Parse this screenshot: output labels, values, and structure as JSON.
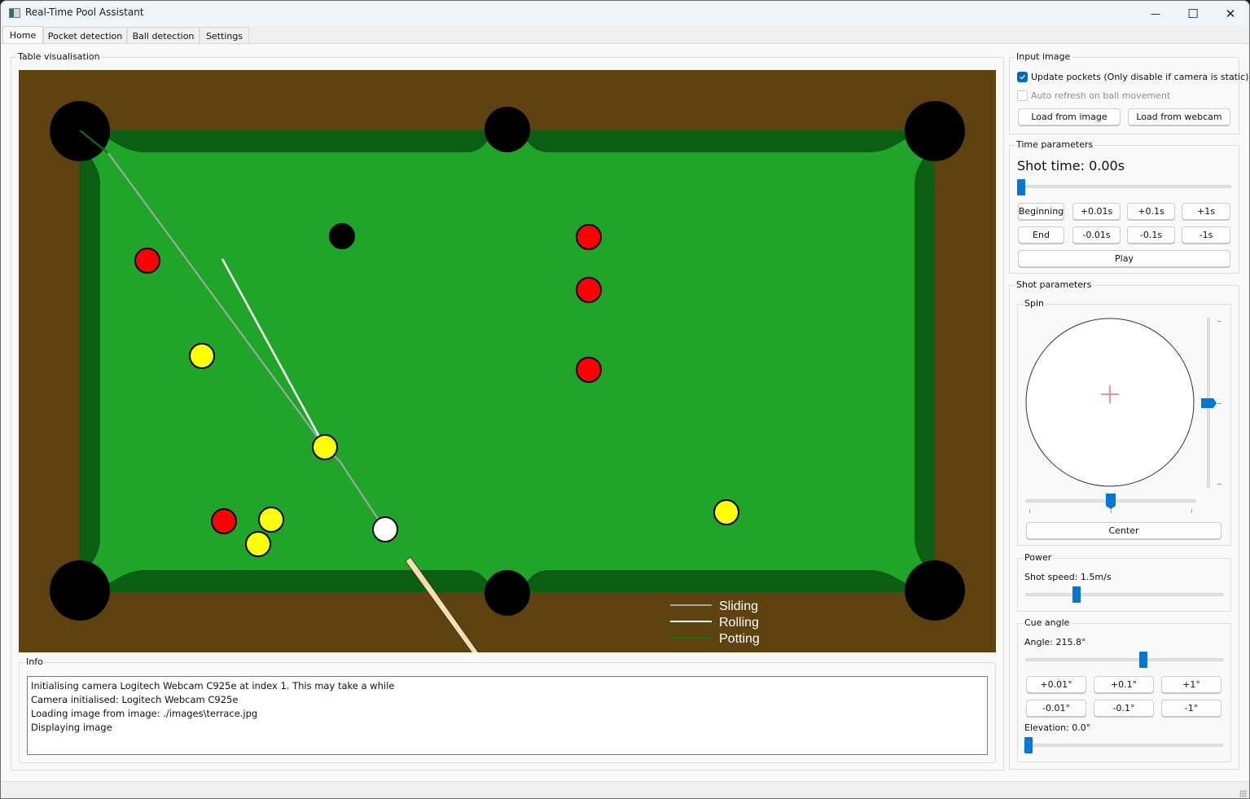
{
  "window": {
    "title": "Real-Time Pool Assistant",
    "controls": {
      "minimize": "—",
      "maximize": "☐",
      "close": "✕"
    }
  },
  "tabs": [
    {
      "label": "Home",
      "active": true
    },
    {
      "label": "Pocket detection",
      "active": false
    },
    {
      "label": "Ball detection",
      "active": false
    },
    {
      "label": "Settings",
      "active": false
    }
  ],
  "table_visualisation": {
    "title": "Table visualisation",
    "colors": {
      "frame": "#5e4210",
      "cushion": "#0b5e12",
      "cloth": "#1fa628",
      "pocket": "#000000",
      "cue": "#f5deb3",
      "sliding": "#a8a8a8",
      "rolling": "#ffffff",
      "potting": "#0b7a0b"
    },
    "balls": [
      {
        "color": "red",
        "fill": "#ff0000"
      },
      {
        "color": "red",
        "fill": "#ff0000"
      },
      {
        "color": "red",
        "fill": "#ff0000"
      },
      {
        "color": "red",
        "fill": "#ff0000"
      },
      {
        "color": "red",
        "fill": "#ff0000"
      },
      {
        "color": "black",
        "fill": "#000000"
      },
      {
        "color": "yellow",
        "fill": "#ffff00"
      },
      {
        "color": "yellow",
        "fill": "#ffff00"
      },
      {
        "color": "yellow",
        "fill": "#ffff00"
      },
      {
        "color": "yellow",
        "fill": "#ffff00"
      },
      {
        "color": "yellow",
        "fill": "#ffff00"
      },
      {
        "color": "white",
        "fill": "#ffffff"
      }
    ],
    "legend": [
      {
        "label": "Sliding",
        "color": "#a8a8a8"
      },
      {
        "label": "Rolling",
        "color": "#ffffff"
      },
      {
        "label": "Potting",
        "color": "#0b7a0b"
      }
    ]
  },
  "info": {
    "title": "Info",
    "lines": [
      "Initialising camera Logitech Webcam C925e at index 1. This may take a while",
      "Camera initialised: Logitech Webcam C925e",
      "Loading image from image: ./images\\terrace.jpg",
      "Displaying image"
    ]
  },
  "input_image": {
    "title": "Input image",
    "update_pockets": {
      "label": "Update pockets (Only disable if camera is static)",
      "checked": true
    },
    "auto_refresh": {
      "label": "Auto refresh on ball movement",
      "checked": false,
      "disabled": true
    },
    "load_image_label": "Load from image",
    "load_webcam_label": "Load from webcam"
  },
  "time_parameters": {
    "title": "Time parameters",
    "shot_time_label": "Shot time: 0.00s",
    "shot_time_fraction": 0.0,
    "buttons_row1": [
      "Beginning",
      "+0.01s",
      "+0.1s",
      "+1s"
    ],
    "buttons_row2": [
      "End",
      "-0.01s",
      "-0.1s",
      "-1s"
    ],
    "play_label": "Play"
  },
  "shot_parameters": {
    "title": "Shot parameters",
    "spin": {
      "title": "Spin",
      "horizontal_fraction": 0.5,
      "vertical_fraction": 0.5,
      "center_label": "Center"
    },
    "power": {
      "title": "Power",
      "speed_label": "Shot speed: 1.5m/s",
      "speed_fraction": 0.25
    },
    "cue_angle": {
      "title": "Cue angle",
      "angle_label": "Angle: 215.8°",
      "angle_fraction": 0.6,
      "buttons_row1": [
        "+0.01°",
        "+0.1°",
        "+1°"
      ],
      "buttons_row2": [
        "-0.01°",
        "-0.1°",
        "-1°"
      ],
      "elevation_label": "Elevation: 0.0°",
      "elevation_fraction": 0.0
    }
  }
}
